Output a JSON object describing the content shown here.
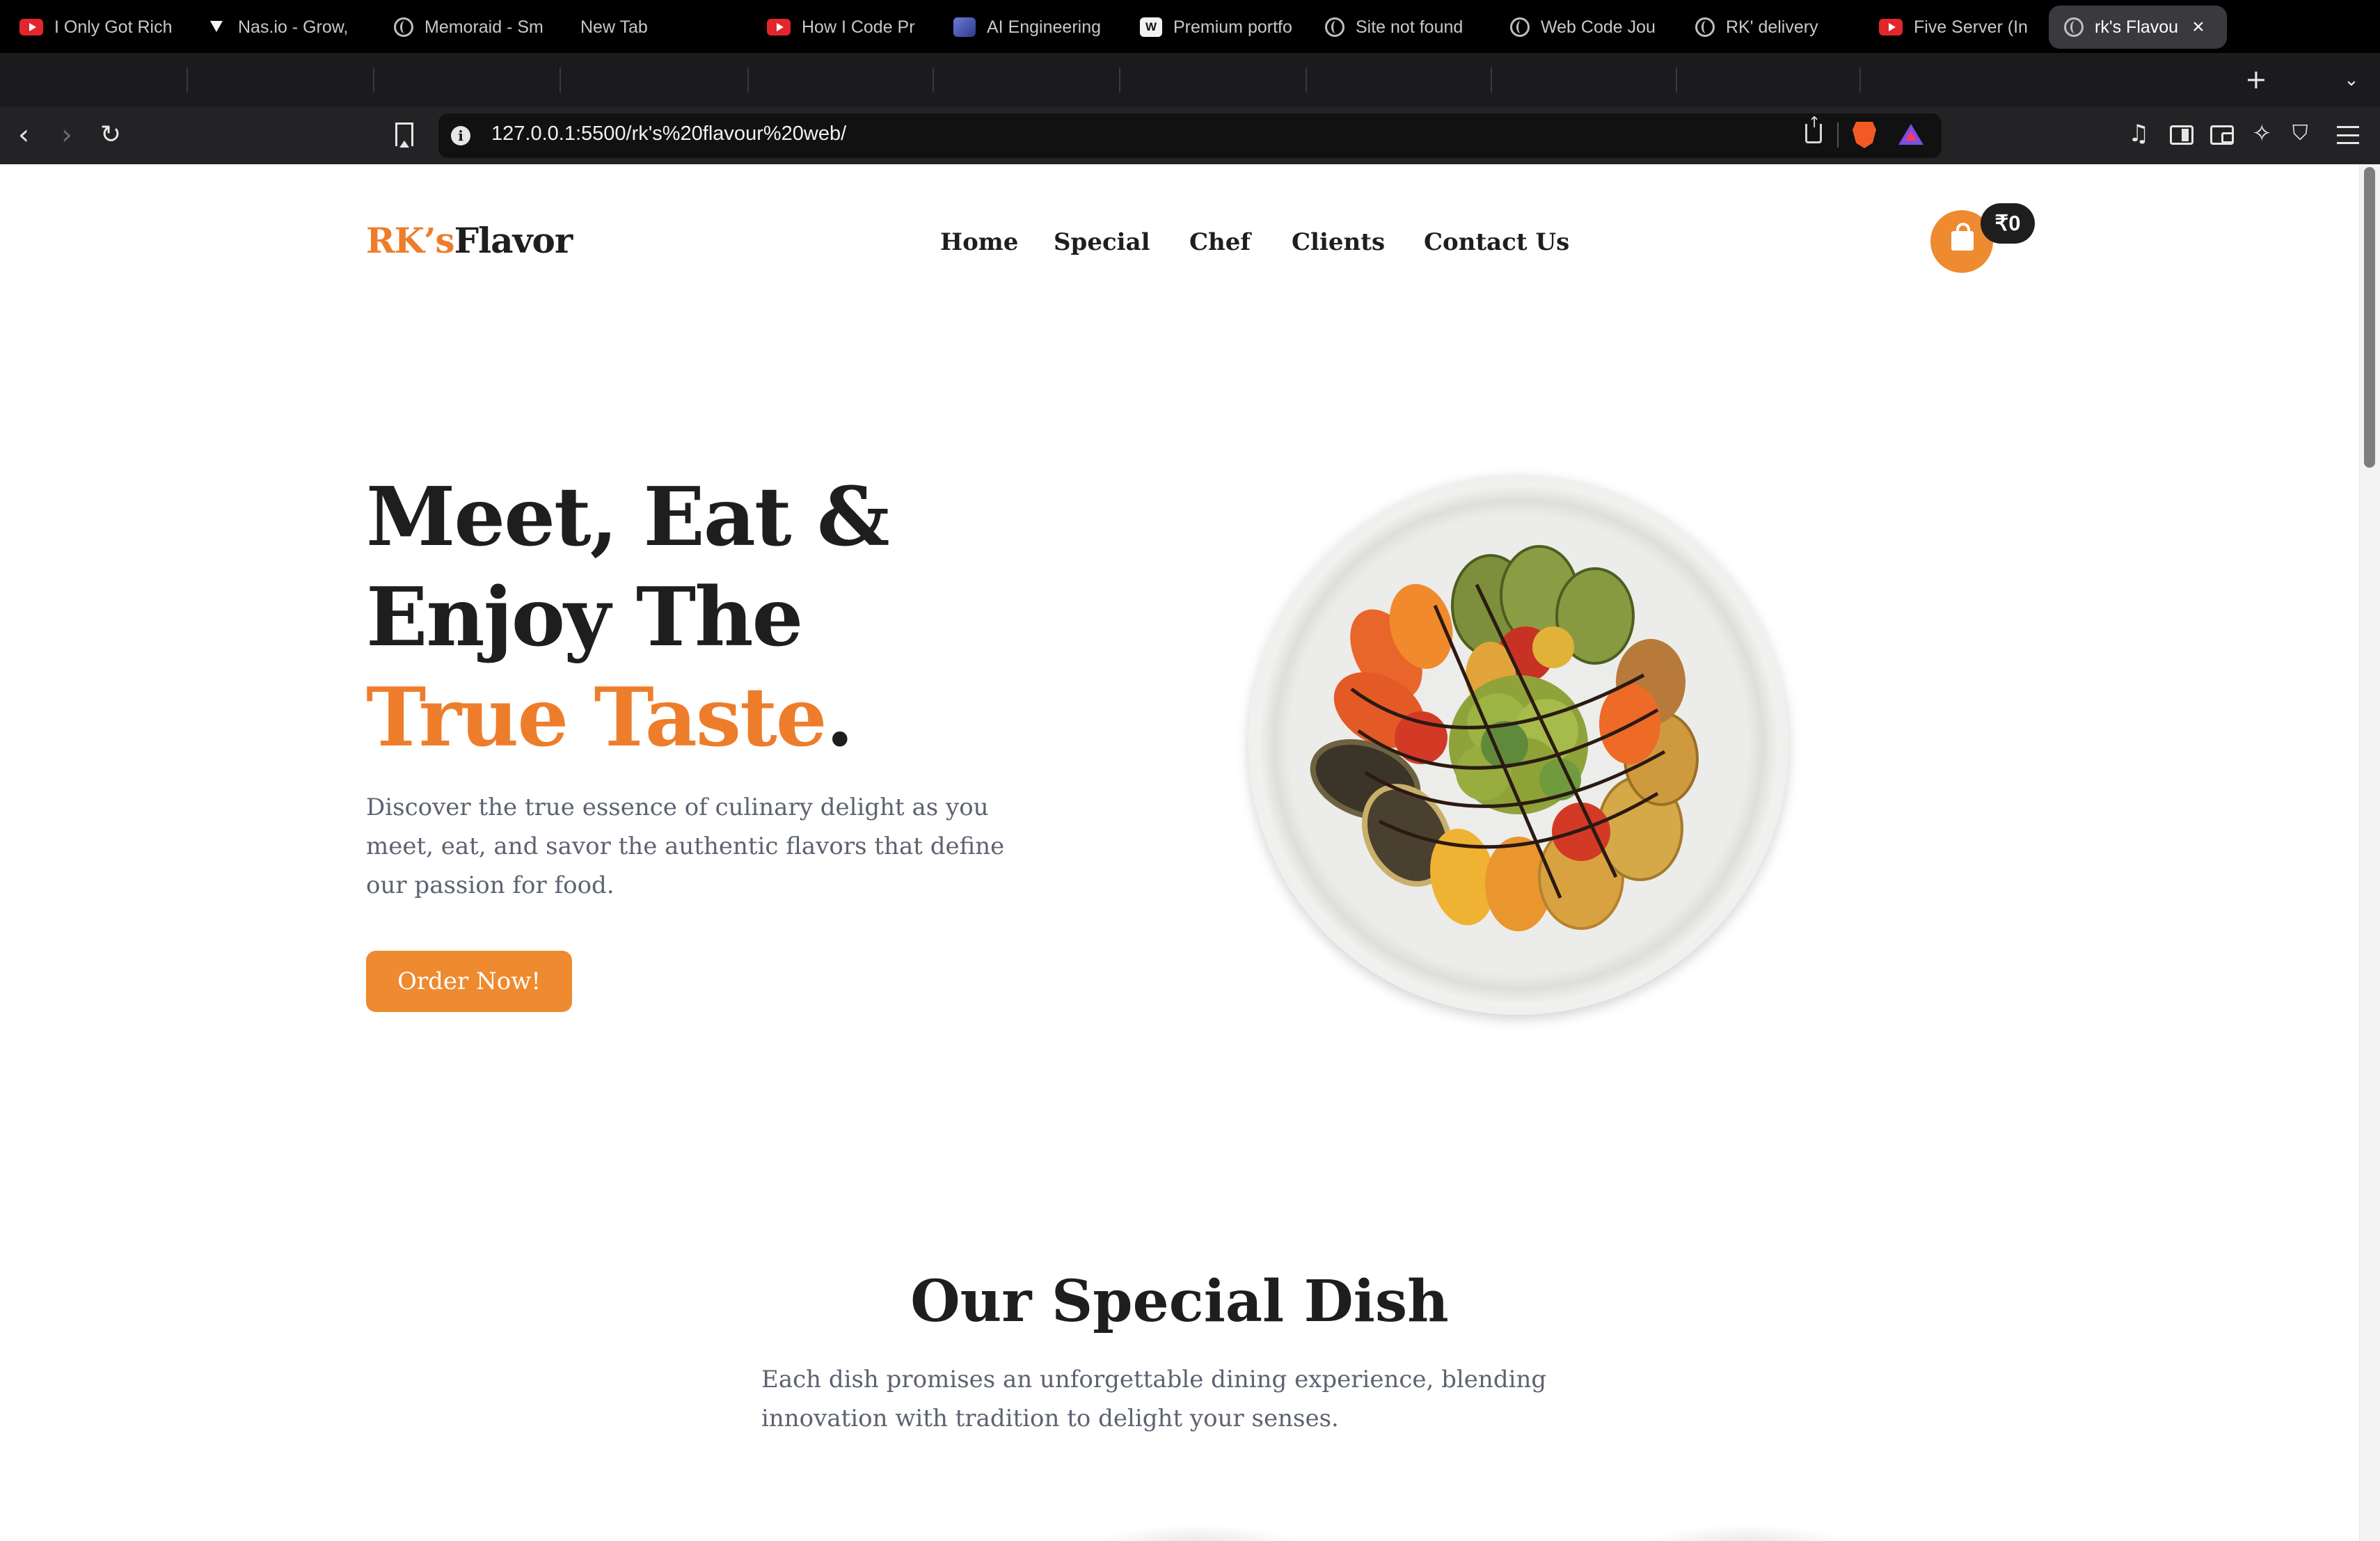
{
  "browser": {
    "tabs": [
      {
        "title": "I Only Got Rich",
        "icon": "youtube-icon"
      },
      {
        "title": "Nas.io - Grow,",
        "icon": "nas-icon"
      },
      {
        "title": "Memoraid - Sm",
        "icon": "globe-icon"
      },
      {
        "title": "New Tab",
        "icon": ""
      },
      {
        "title": "How I Code Pr",
        "icon": "youtube-icon"
      },
      {
        "title": "AI Engineering",
        "icon": "ai-icon"
      },
      {
        "title": "Premium portfo",
        "icon": "w-icon"
      },
      {
        "title": "Site not found",
        "icon": "globe-icon"
      },
      {
        "title": "Web Code Jou",
        "icon": "globe-icon"
      },
      {
        "title": "RK' delivery",
        "icon": "globe-icon"
      },
      {
        "title": "Five Server (In",
        "icon": "youtube-icon"
      },
      {
        "title": "rk's Flavou",
        "icon": "globe-icon",
        "active": true
      }
    ],
    "url": "127.0.0.1:5500/rk's%20flavour%20web/",
    "close_icon": "×",
    "new_tab_icon": "+",
    "tab_list_icon": "⌄"
  },
  "site": {
    "logo_part1": "RK’s",
    "logo_part2": "Flavor",
    "nav": [
      "Home",
      "Special",
      "Chef",
      "Clients",
      "Contact Us"
    ],
    "cart_total": "₹0",
    "hero": {
      "line1": "Meet, Eat &",
      "line2": "Enjoy The",
      "line3_accent": "True Taste",
      "line3_end": ".",
      "description": "Discover the true essence of culinary delight as you meet, eat, and savor the authentic flavors that define our passion for food.",
      "cta": "Order Now!"
    },
    "special": {
      "title": "Our Special Dish",
      "description": "Each dish promises an unforgettable dining experience, blending innovation with tradition to delight your senses."
    },
    "colors": {
      "accent": "#ee7d2b",
      "text": "#1e1e1e",
      "muted": "#5d6270"
    }
  }
}
